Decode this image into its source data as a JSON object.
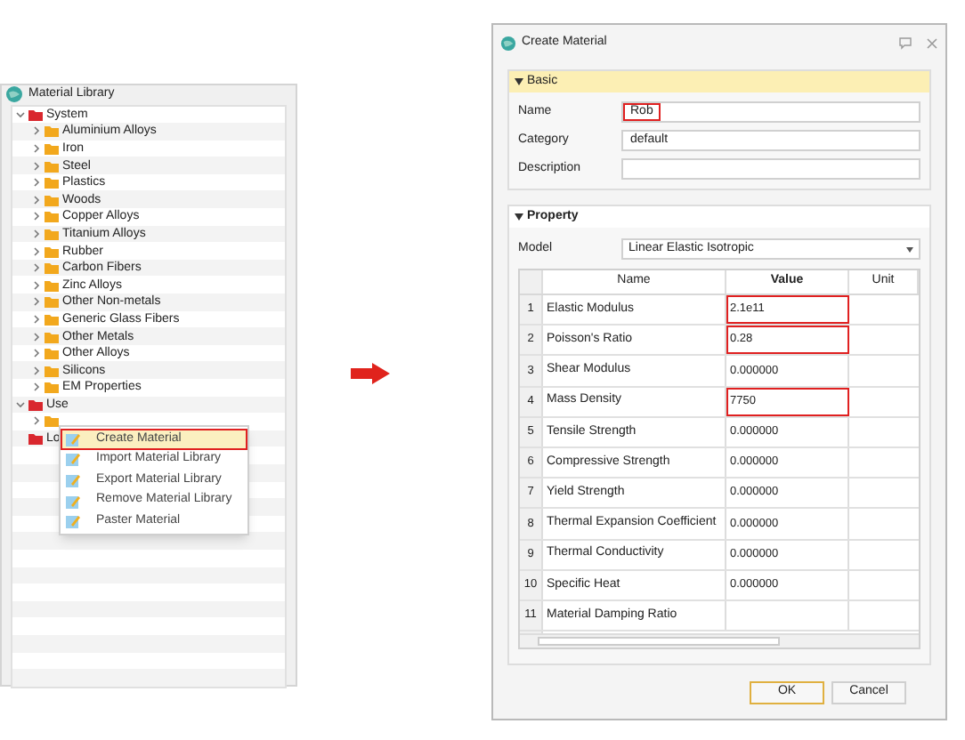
{
  "library": {
    "title": "Material Library",
    "tree": [
      {
        "label": "System",
        "kind": "root",
        "expanded": true,
        "children": [
          {
            "label": "Aluminium Alloys",
            "kind": "folder",
            "expanded": false
          },
          {
            "label": "Iron",
            "kind": "folder",
            "expanded": false
          },
          {
            "label": "Steel",
            "kind": "folder",
            "expanded": false
          },
          {
            "label": "Plastics",
            "kind": "folder",
            "expanded": false
          },
          {
            "label": "Woods",
            "kind": "folder",
            "expanded": false
          },
          {
            "label": "Copper Alloys",
            "kind": "folder",
            "expanded": false
          },
          {
            "label": "Titanium Alloys",
            "kind": "folder",
            "expanded": false
          },
          {
            "label": "Rubber",
            "kind": "folder",
            "expanded": false
          },
          {
            "label": "Carbon Fibers",
            "kind": "folder",
            "expanded": false
          },
          {
            "label": "Zinc Alloys",
            "kind": "folder",
            "expanded": false
          },
          {
            "label": "Other Non-metals",
            "kind": "folder",
            "expanded": false
          },
          {
            "label": "Generic Glass Fibers",
            "kind": "folder",
            "expanded": false
          },
          {
            "label": "Other Metals",
            "kind": "folder",
            "expanded": false
          },
          {
            "label": "Other Alloys",
            "kind": "folder",
            "expanded": false
          },
          {
            "label": "Silicons",
            "kind": "folder",
            "expanded": false
          },
          {
            "label": "EM Properties",
            "kind": "folder",
            "expanded": false
          }
        ]
      },
      {
        "label": "Use",
        "kind": "root",
        "expanded": true,
        "children": [
          {
            "kind": "folder",
            "expanded": false
          }
        ]
      },
      {
        "label": "Lo",
        "kind": "root"
      }
    ],
    "context_menu": [
      {
        "label": "Create Material",
        "selected": true,
        "highlighted": true
      },
      {
        "label": "Import Material Library",
        "selected": false,
        "highlighted": false
      },
      {
        "label": "Export Material Library",
        "selected": false,
        "highlighted": false
      },
      {
        "label": "Remove Material Library",
        "selected": false,
        "highlighted": false
      },
      {
        "label": "Paster Material",
        "selected": false,
        "highlighted": false
      }
    ]
  },
  "dialog": {
    "title": "Create Material",
    "basic": {
      "title": "Basic",
      "expanded": true,
      "fields": [
        {
          "label": "Name",
          "value": "Rob",
          "highlighted": true
        },
        {
          "label": "Category",
          "value": "default",
          "highlighted": false
        },
        {
          "label": "Description",
          "highlighted": false
        }
      ]
    },
    "property": {
      "title": "Property",
      "expanded": true,
      "model_label": "Model",
      "model_value": "Linear Elastic Isotropic",
      "columns": [
        "Name",
        "Value",
        "Unit"
      ],
      "rows": [
        {
          "index": "1",
          "name": "Elastic Modulus",
          "value": "2.1e11",
          "highlighted": true
        },
        {
          "index": "2",
          "name": "Poisson's Ratio",
          "value": "0.28",
          "highlighted": true
        },
        {
          "index": "3",
          "name": "Shear Modulus",
          "value": "0.000000",
          "highlighted": false
        },
        {
          "index": "4",
          "name": "Mass Density",
          "value": "7750",
          "highlighted": true
        },
        {
          "index": "5",
          "name": "Tensile Strength",
          "value": "0.000000",
          "highlighted": false
        },
        {
          "index": "6",
          "name": "Compressive Strength",
          "value": "0.000000",
          "highlighted": false
        },
        {
          "index": "7",
          "name": "Yield Strength",
          "value": "0.000000",
          "highlighted": false
        },
        {
          "index": "8",
          "name": "Thermal Expansion Coefficient",
          "value": "0.000000",
          "highlighted": false
        },
        {
          "index": "9",
          "name": "Thermal Conductivity",
          "value": "0.000000",
          "highlighted": false
        },
        {
          "index": "10",
          "name": "Specific Heat",
          "value": "0.000000",
          "highlighted": false
        },
        {
          "index": "11",
          "name": "Material Damping Ratio",
          "highlighted": false
        }
      ]
    },
    "buttons": [
      {
        "label": "OK",
        "default": true
      },
      {
        "label": "Cancel",
        "default": false
      }
    ]
  }
}
